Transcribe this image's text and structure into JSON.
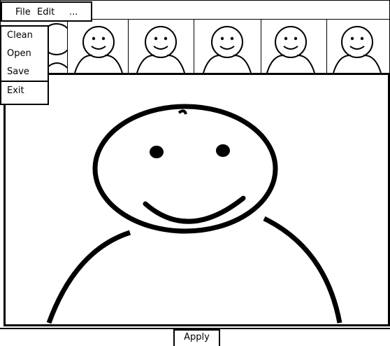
{
  "menubar": {
    "items": [
      "File",
      "Edit",
      "..."
    ]
  },
  "dropdown": {
    "items": [
      "Clean",
      "Open",
      "Save"
    ],
    "exit_label": "Exit"
  },
  "thumbnails": {
    "count": 7,
    "icon": "person-smiley-icon"
  },
  "viewport": {
    "icon": "person-smiley-icon"
  },
  "footer": {
    "apply_label": "Apply"
  }
}
